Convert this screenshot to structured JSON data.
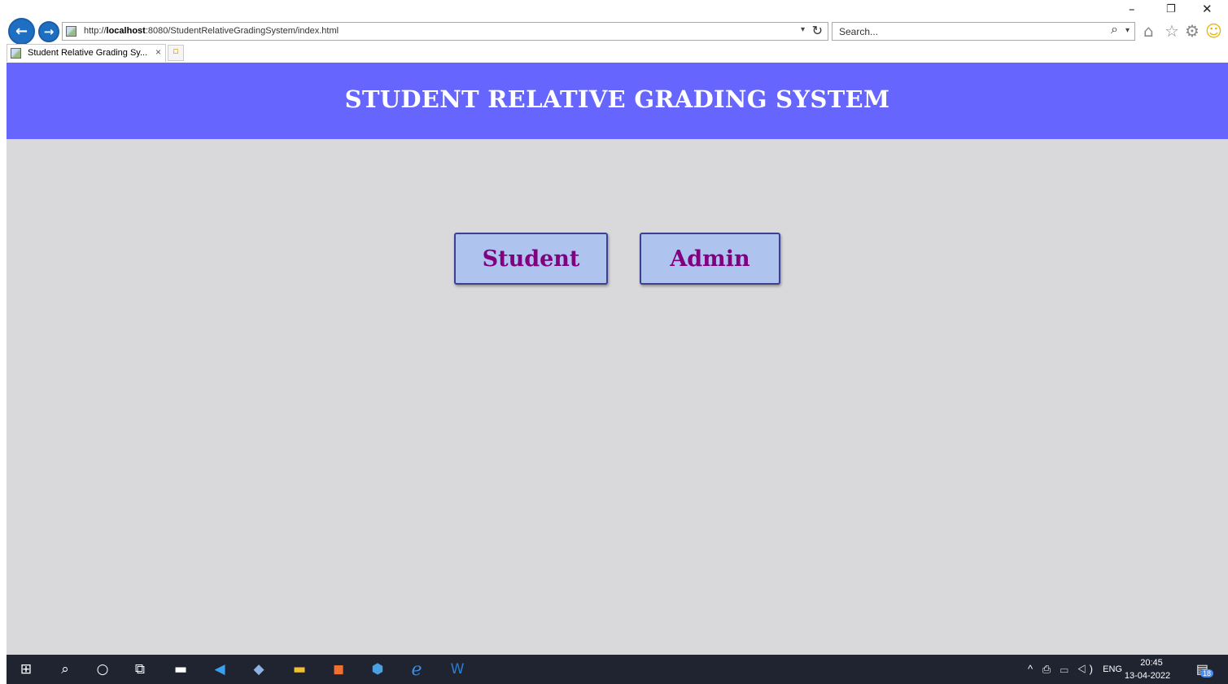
{
  "browser": {
    "url_prefix": "http://",
    "url_host": "localhost",
    "url_rest": ":8080/StudentRelativeGradingSystem/index.html",
    "search_placeholder": "Search...",
    "tab_title": "Student Relative Grading Sy...",
    "tab_close": "×"
  },
  "page": {
    "title": "STUDENT RELATIVE GRADING SYSTEM",
    "student_label": "Student",
    "admin_label": "Admin",
    "header_color": "#6666ff",
    "button_text_color": "#800080",
    "button_bg_color": "#aec4ee"
  },
  "taskbar": {
    "time": "20:45",
    "date": "13-04-2022",
    "language": "ENG",
    "notification_count": "18"
  }
}
